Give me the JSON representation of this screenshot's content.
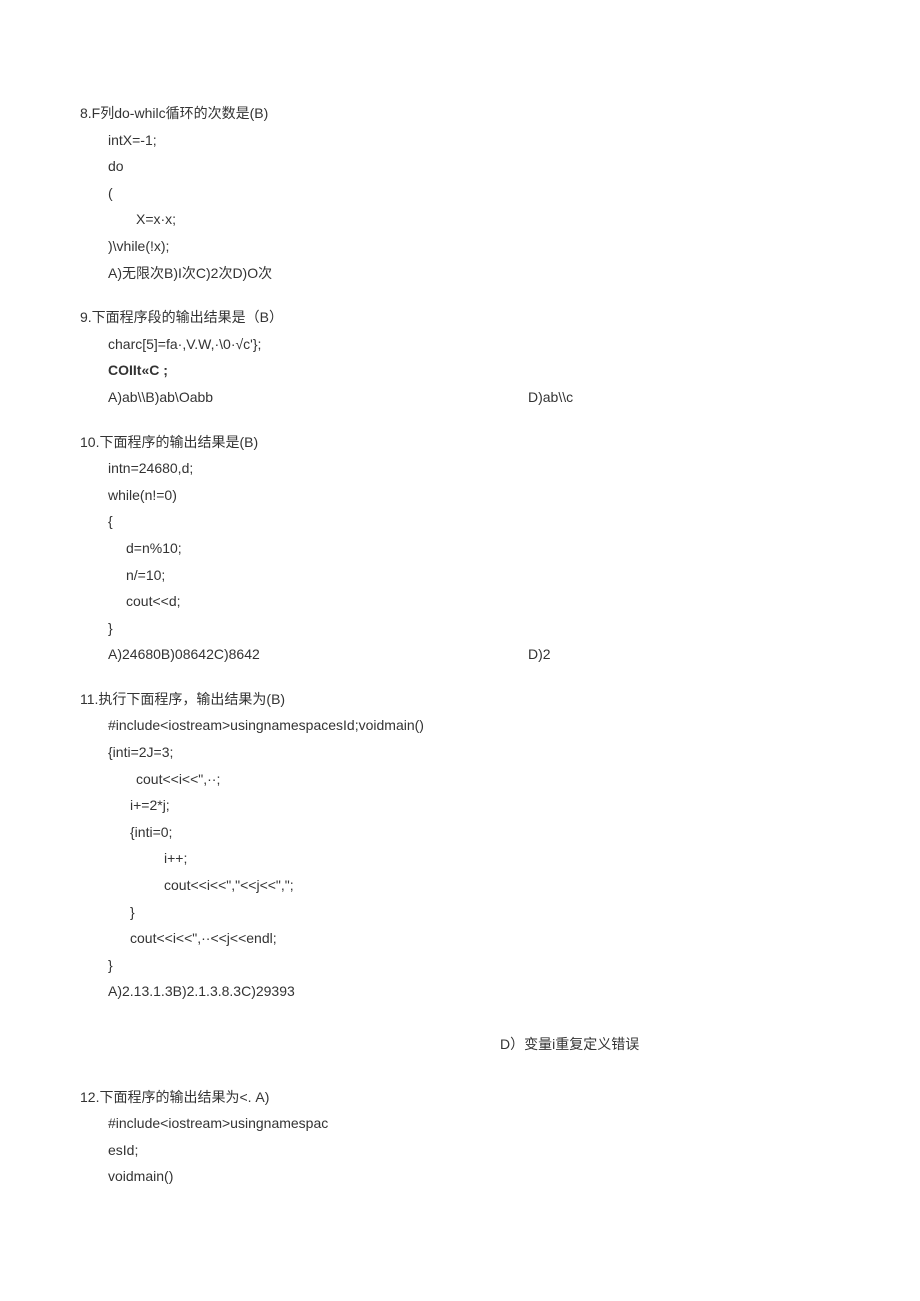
{
  "q8": {
    "title": "8.F列do-whilc循环的次数是(B)",
    "l1": "intX=-1;",
    "l2": "do",
    "l3": "(",
    "l4": "X=x·x;",
    "l5": ")\\vhile(!x);",
    "opts": "A)无限次B)I次C)2次D)O次"
  },
  "q9": {
    "title": "9.下面程序段的输出结果是（B）",
    "l1": "charc[5]=fa·,V.W,·\\0·√c'};",
    "l2": "COIIt«C ;",
    "optsLeft": "A)ab\\\\B)ab\\Oabb",
    "optsRight": "D)ab\\\\c"
  },
  "q10": {
    "title": "10.下面程序的输出结果是(B)",
    "l1": "intn=24680,d;",
    "l2": "while(n!=0)",
    "l3": "{",
    "l4": "d=n%10;",
    "l5": "n/=10;",
    "l6": "cout<<d;",
    "l7": "}",
    "optsLeft": "A)24680B)08642C)8642",
    "optsRight": "D)2"
  },
  "q11": {
    "title": "11.执行下面程序，输出结果为(B)",
    "l1": "#include<iostream>usingnamespacesId;voidmain()",
    "l2": "{inti=2J=3;",
    "l3": "cout<<i<<\",··;",
    "l4": "i+=2*j;",
    "l5": "{inti=0;",
    "l6": "i++;",
    "l7": "cout<<i<<\",\"<<j<<\",\";",
    "l8": "}",
    "l9": "cout<<i<<\",··<<j<<endl;",
    "l10": "}",
    "opts": "A)2.13.1.3B)2.1.3.8.3C)29393",
    "optD": "D）变量i重复定义错误"
  },
  "q12": {
    "title": "12.下面程序的输出结果为<. A)",
    "l1": "#include<iostream>usingnamespac",
    "l2": "esId;",
    "l3": "voidmain()"
  }
}
